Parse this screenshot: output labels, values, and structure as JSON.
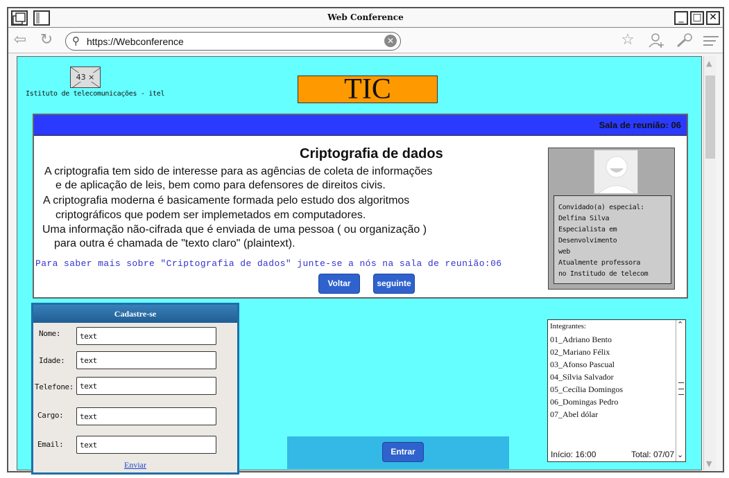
{
  "window": {
    "title": "Web Conference"
  },
  "browser": {
    "url": "https://Webconference"
  },
  "header": {
    "logo_placeholder": "43 × 31",
    "org_name": "Istituto de telecomunicações - itel",
    "banner": "TIC"
  },
  "room": {
    "label": "Sala de reunião: 06",
    "title": "Criptografia de dados",
    "paragraphs": [
      "A criptografia tem sido de interesse para as agências de coleta de informações",
      "e de aplicação de leis, bem como para defensores de direitos civis.",
      "A criptografia moderna é basicamente formada pelo estudo dos algoritmos",
      "criptográficos que podem ser implemetados em computadores.",
      "Uma informação não-cifrada que é enviada de uma pessoa ( ou organização )",
      "para outra é chamada de \"texto claro\" (plaintext)."
    ],
    "join_text": "Para saber mais sobre \"Criptografia de dados\" junte-se a nós na sala de reunião:06",
    "back_label": "Voltar",
    "next_label": "seguinte"
  },
  "guest": {
    "lines": [
      "Convidado(a) especial:",
      "Delfina Silva",
      "Especialista em",
      "Desenvolvimento",
      "web",
      "Atualmente professora",
      "no Institudo de telecom"
    ]
  },
  "form": {
    "title": "Cadastre-se",
    "fields": [
      {
        "label": "Nome:",
        "value": "text"
      },
      {
        "label": "Idade:",
        "value": "text"
      },
      {
        "label": "Telefone:",
        "value": "text"
      },
      {
        "label": "Cargo:",
        "value": "text"
      },
      {
        "label": "Email:",
        "value": "text"
      }
    ],
    "send_label": "Enviar"
  },
  "entrar_label": "Entrar",
  "members": {
    "header": "Integrantes:",
    "items": [
      "01_Adriano Bento",
      "02_Mariano Félix",
      "03_Afonso Pascual",
      "04_Sílvia Salvador",
      "05_Cecília Domingos",
      "06_Domingas Pedro",
      "07_Abel dólar"
    ],
    "start": "Início: 16:00",
    "total": "Total: 07/07"
  }
}
